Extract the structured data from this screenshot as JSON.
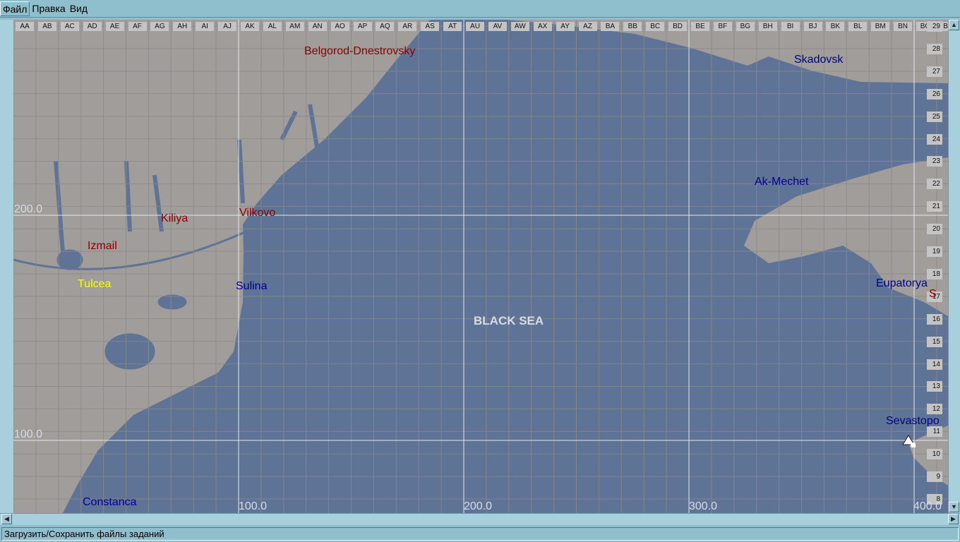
{
  "menu": {
    "items": [
      "Файл",
      "Правка",
      "Вид"
    ]
  },
  "grid": {
    "columns": [
      "AA",
      "AB",
      "AC",
      "AD",
      "AE",
      "AF",
      "AG",
      "AH",
      "AI",
      "AJ",
      "AK",
      "AL",
      "AM",
      "AN",
      "AO",
      "AP",
      "AQ",
      "AR",
      "AS",
      "AT",
      "AU",
      "AV",
      "AW",
      "AX",
      "AY",
      "AZ",
      "BA",
      "BB",
      "BC",
      "BD",
      "BE",
      "BF",
      "BG",
      "BH",
      "BI",
      "BJ",
      "BK",
      "BL",
      "BM",
      "BN",
      "BO",
      "BP"
    ],
    "rows": [
      "29",
      "28",
      "27",
      "26",
      "25",
      "24",
      "23",
      "22",
      "21",
      "20",
      "19",
      "18",
      "17",
      "16",
      "15",
      "14",
      "13",
      "12",
      "11",
      "10",
      "9",
      "8"
    ],
    "x_coords": [
      "100.0",
      "200.0",
      "300.0",
      "400.0"
    ],
    "y_coords": [
      "200.0",
      "100.0"
    ]
  },
  "map": {
    "sea_label": "BLACK SEA",
    "colors": {
      "land": "#a09d9a",
      "sea": "#5f7396",
      "red_city": "#8b0000",
      "blue_city": "#00008b",
      "neutral_city": "#ffff00"
    },
    "cities": [
      {
        "name": "Belgorod-Dnestrovsky",
        "side": "red"
      },
      {
        "name": "Skadovsk",
        "side": "blue"
      },
      {
        "name": "Ak-Mechet",
        "side": "blue"
      },
      {
        "name": "Kiliya",
        "side": "red"
      },
      {
        "name": "Vilkovo",
        "side": "red"
      },
      {
        "name": "Izmail",
        "side": "red"
      },
      {
        "name": "Tulcea",
        "side": "neutral"
      },
      {
        "name": "Sulina",
        "side": "blue"
      },
      {
        "name": "Eupatorya",
        "side": "blue"
      },
      {
        "name": "S",
        "side": "red"
      },
      {
        "name": "Sevastopo",
        "side": "blue"
      },
      {
        "name": "Constanca",
        "side": "blue"
      }
    ]
  },
  "status": {
    "text": "Загрузить/Сохранить файлы заданий"
  }
}
